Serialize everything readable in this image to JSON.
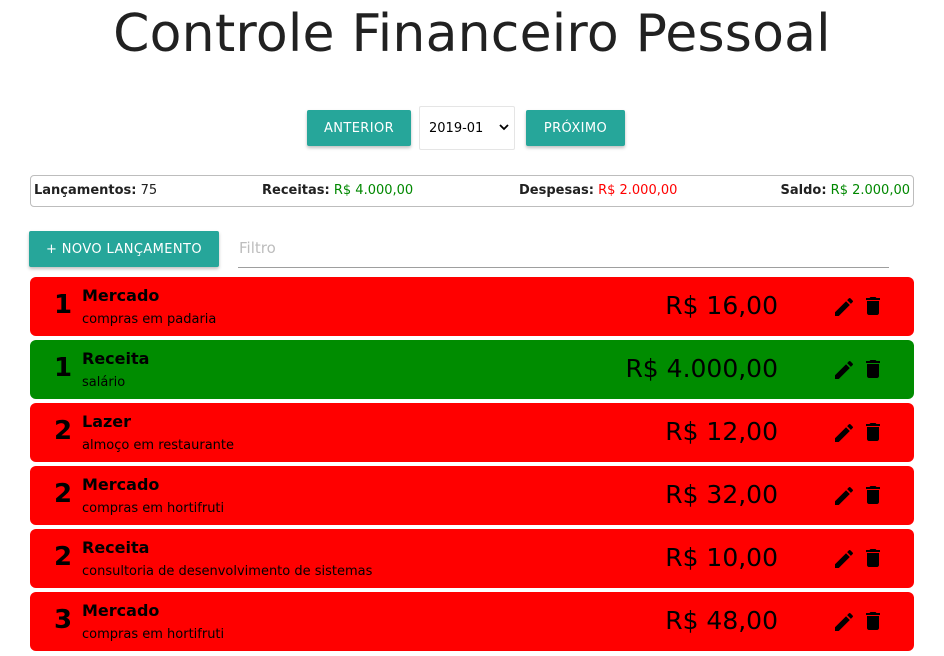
{
  "page": {
    "title": "Controle Financeiro Pessoal"
  },
  "period": {
    "prev_label": "ANTERIOR",
    "next_label": "PRÓXIMO",
    "selected": "2019-01"
  },
  "summary": {
    "entries_label": "Lançamentos:",
    "entries_value": "75",
    "income_label": "Receitas:",
    "income_value": "R$ 4.000,00",
    "expense_label": "Despesas:",
    "expense_value": "R$ 2.000,00",
    "balance_label": "Saldo:",
    "balance_value": "R$ 2.000,00",
    "colors": {
      "income": "#008800",
      "expense": "#ff0000",
      "balance": "#008800"
    }
  },
  "actions": {
    "new_label": "+ NOVO LANÇAMENTO",
    "filter_placeholder": "Filtro"
  },
  "colors": {
    "accent": "#26a69a",
    "expense_row": "#ff0000",
    "income_row": "#008c00"
  },
  "icons": {
    "edit": "pencil-icon",
    "delete": "trash-icon",
    "dropdown": "chevron-down-icon"
  },
  "entries": [
    {
      "day": "1",
      "category": "Mercado",
      "description": "compras em padaria",
      "value": "R$ 16,00",
      "type": "expense"
    },
    {
      "day": "1",
      "category": "Receita",
      "description": "salário",
      "value": "R$ 4.000,00",
      "type": "income"
    },
    {
      "day": "2",
      "category": "Lazer",
      "description": "almoço em restaurante",
      "value": "R$ 12,00",
      "type": "expense"
    },
    {
      "day": "2",
      "category": "Mercado",
      "description": "compras em hortifruti",
      "value": "R$ 32,00",
      "type": "expense"
    },
    {
      "day": "2",
      "category": "Receita",
      "description": "consultoria de desenvolvimento de sistemas",
      "value": "R$ 10,00",
      "type": "expense"
    },
    {
      "day": "3",
      "category": "Mercado",
      "description": "compras em hortifruti",
      "value": "R$ 48,00",
      "type": "expense"
    }
  ]
}
